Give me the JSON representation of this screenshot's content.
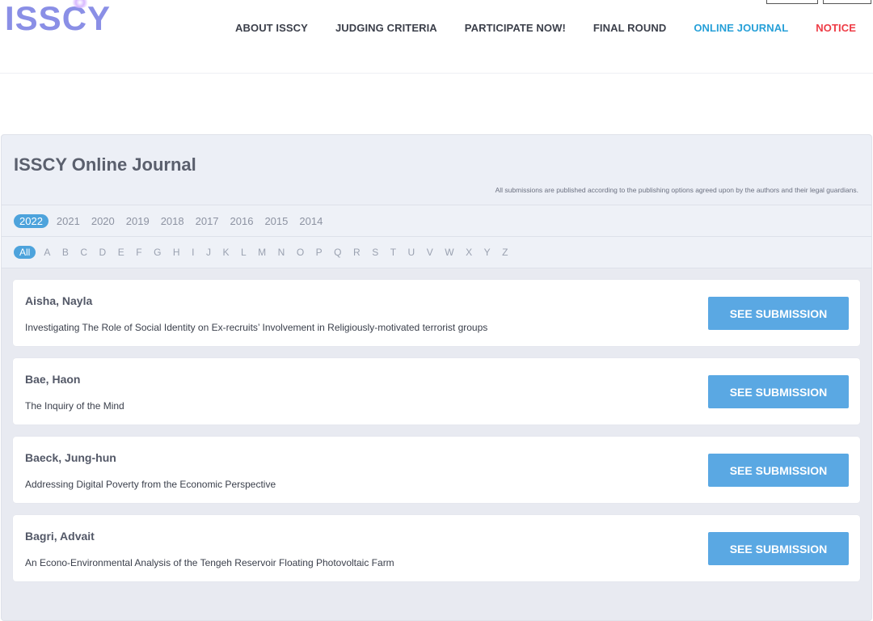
{
  "header": {
    "logo": "ISSCY",
    "nav": [
      {
        "label": "ABOUT ISSCY"
      },
      {
        "label": "JUDGING CRITERIA"
      },
      {
        "label": "PARTICIPATE NOW!"
      },
      {
        "label": "FINAL ROUND"
      },
      {
        "label": "ONLINE JOURNAL"
      },
      {
        "label": "NOTICE"
      }
    ]
  },
  "journal": {
    "title": "ISSCY Online Journal",
    "note": "All submissions are published according to the publishing options agreed upon by the authors and their legal guardians.",
    "years": [
      "2022",
      "2021",
      "2020",
      "2019",
      "2018",
      "2017",
      "2016",
      "2015",
      "2014"
    ],
    "letters": [
      "All",
      "A",
      "B",
      "C",
      "D",
      "E",
      "F",
      "G",
      "H",
      "I",
      "J",
      "K",
      "L",
      "M",
      "N",
      "O",
      "P",
      "Q",
      "R",
      "S",
      "T",
      "U",
      "V",
      "W",
      "X",
      "Y",
      "Z"
    ],
    "entries": [
      {
        "name": "Aisha, Nayla",
        "title": "Investigating The Role of Social Identity on Ex-recruits’ Involvement in Religiously-motivated terrorist groups",
        "button": "SEE SUBMISSION"
      },
      {
        "name": "Bae, Haon",
        "title": "The Inquiry of the Mind",
        "button": "SEE SUBMISSION"
      },
      {
        "name": "Baeck, Jung-hun",
        "title": "Addressing Digital Poverty from the Economic Perspective",
        "button": "SEE SUBMISSION"
      },
      {
        "name": "Bagri, Advait",
        "title": "An Econo-Environmental Analysis of the Tengeh Reservoir Floating Photovoltaic Farm",
        "button": "SEE SUBMISSION"
      }
    ]
  }
}
